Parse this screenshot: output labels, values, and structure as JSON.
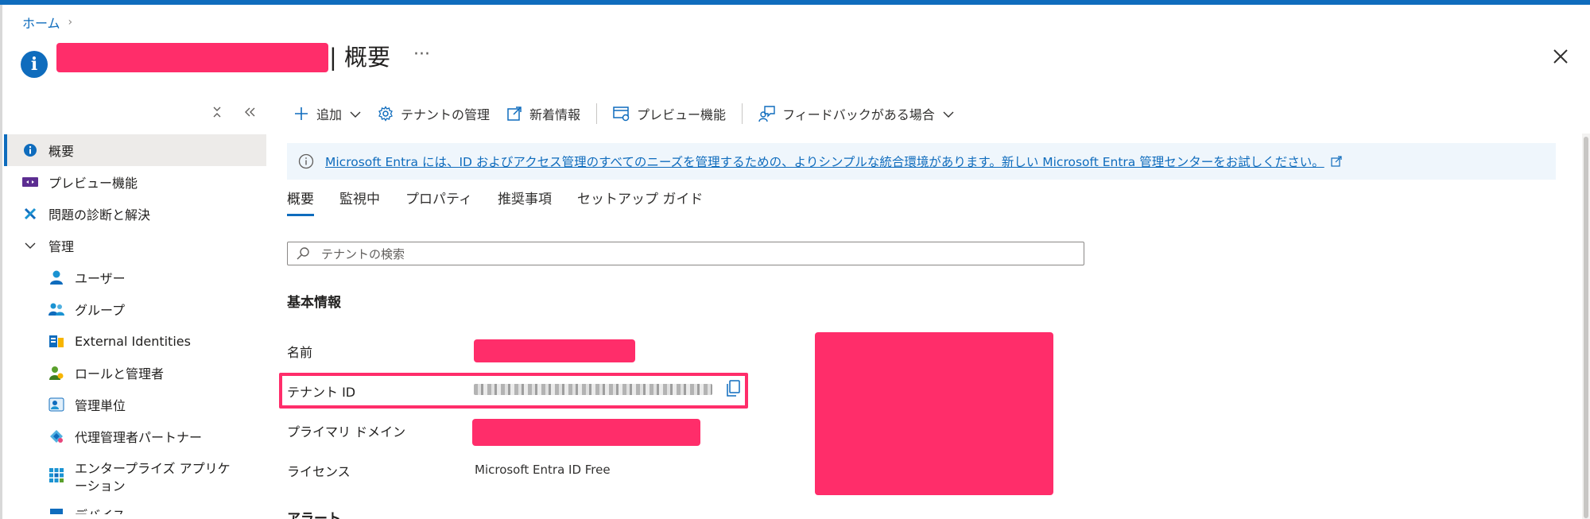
{
  "breadcrumb": {
    "home": "ホーム"
  },
  "header": {
    "title": "| 概要",
    "more": "···"
  },
  "sidebar": {
    "items": [
      {
        "label": "概要"
      },
      {
        "label": "プレビュー機能"
      },
      {
        "label": "問題の診断と解決"
      },
      {
        "label": "管理"
      },
      {
        "label": "ユーザー"
      },
      {
        "label": "グループ"
      },
      {
        "label": "External Identities"
      },
      {
        "label": "ロールと管理者"
      },
      {
        "label": "管理単位"
      },
      {
        "label": "代理管理者パートナー"
      },
      {
        "label": "エンタープライズ アプリケーション"
      },
      {
        "label": "デバイス"
      }
    ]
  },
  "toolbar": {
    "add": "追加",
    "tenant_manage": "テナントの管理",
    "whats_new": "新着情報",
    "preview": "プレビュー機能",
    "feedback": "フィードバックがある場合"
  },
  "banner": {
    "text": "Microsoft Entra には、ID およびアクセス管理のすべてのニーズを管理するための、よりシンプルな統合環境があります。新しい Microsoft Entra 管理センターをお試しください。"
  },
  "tabs": [
    {
      "label": "概要"
    },
    {
      "label": "監視中"
    },
    {
      "label": "プロパティ"
    },
    {
      "label": "推奨事項"
    },
    {
      "label": "セットアップ ガイド"
    }
  ],
  "search": {
    "placeholder": "テナントの検索"
  },
  "basic_info": {
    "title": "基本情報",
    "name_label": "名前",
    "tenant_id_label": "テナント ID",
    "primary_domain_label": "プライマリ ドメイン",
    "license_label": "ライセンス",
    "license_value": "Microsoft Entra ID Free"
  },
  "alerts": {
    "title": "アラート"
  },
  "colors": {
    "accent": "#0f6cbd",
    "redaction": "#ff2d6a",
    "banner_bg": "#eff6fc"
  }
}
